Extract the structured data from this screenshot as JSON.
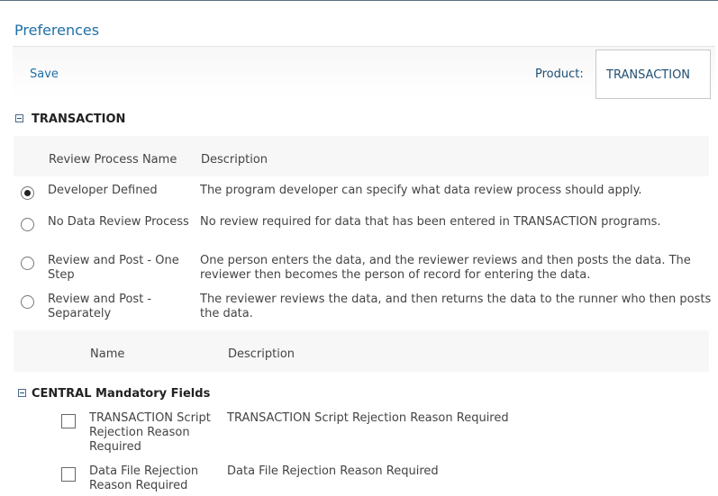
{
  "page": {
    "title": "Preferences"
  },
  "toolbar": {
    "save_label": "Save",
    "product_label": "Product:",
    "product_value": "TRANSACTION"
  },
  "review_section": {
    "title": "TRANSACTION",
    "columns": {
      "name": "Review Process Name",
      "description": "Description"
    },
    "options": [
      {
        "name": "Developer Defined",
        "description": "The program developer can specify what data review process should apply.",
        "selected": true
      },
      {
        "name": "No Data Review Process",
        "description": "No review required for data that has been entered in TRANSACTION programs.",
        "selected": false
      },
      {
        "name": "Review and Post - One Step",
        "description": "One person enters the data, and the reviewer reviews and then posts the data. The reviewer then becomes the person of record for entering the data.",
        "selected": false
      },
      {
        "name": "Review and Post - Separately",
        "description": "The reviewer reviews the data, and then returns the data to the runner who then posts the data.",
        "selected": false
      }
    ]
  },
  "mandatory_section": {
    "columns": {
      "name": "Name",
      "description": "Description"
    },
    "title": "CENTRAL Mandatory Fields",
    "fields": [
      {
        "name": "TRANSACTION Script Rejection Reason Required",
        "description": "TRANSACTION Script Rejection Reason Required",
        "checked": false
      },
      {
        "name": "Data File Rejection Reason Required",
        "description": "Data File Rejection Reason Required",
        "checked": false
      }
    ]
  }
}
